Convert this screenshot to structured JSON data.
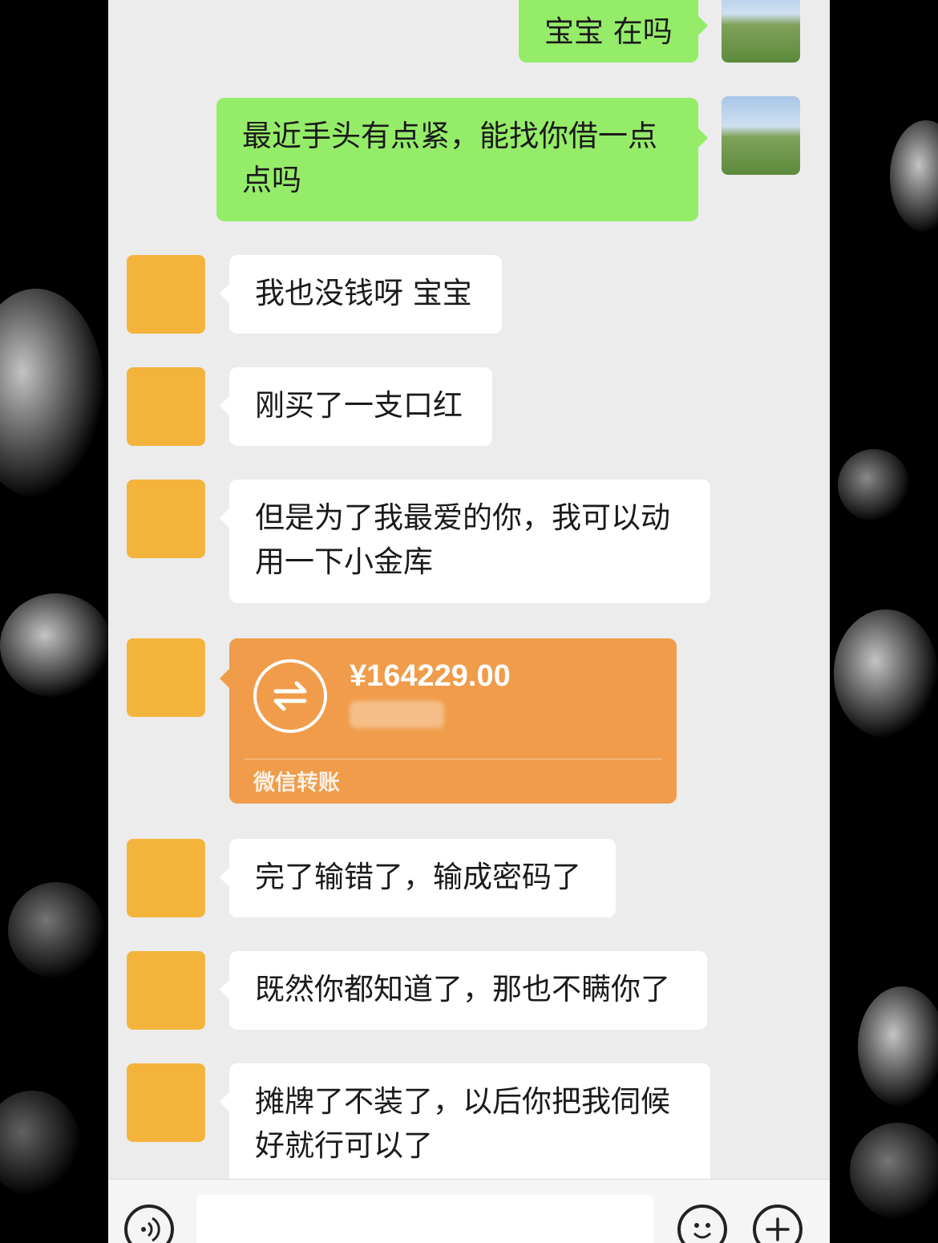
{
  "chat": {
    "outgoing": [
      {
        "text": "宝宝 在吗"
      },
      {
        "text": "最近手头有点紧，能找你借一点点吗"
      }
    ],
    "incoming": [
      {
        "text": "我也没钱呀 宝宝"
      },
      {
        "text": "刚买了一支口红"
      },
      {
        "text": "但是为了我最爱的你，我可以动用一下小金库"
      },
      {
        "text": "完了输错了，输成密码了"
      },
      {
        "text": "既然你都知道了，那也不瞒你了"
      },
      {
        "text": "摊牌了不装了，以后你把我伺候好就行可以了"
      }
    ],
    "transfer": {
      "amount": "¥164229.00",
      "label": "微信转账",
      "icon": "transfer-arrows-icon"
    }
  },
  "inputbar": {
    "voice_icon": "voice-icon",
    "emoji_icon": "emoji-icon",
    "plus_icon": "plus-icon"
  },
  "colors": {
    "outgoing_bubble": "#95ec69",
    "incoming_bubble": "#ffffff",
    "transfer": "#f09c4a",
    "chat_background": "#ececec"
  }
}
